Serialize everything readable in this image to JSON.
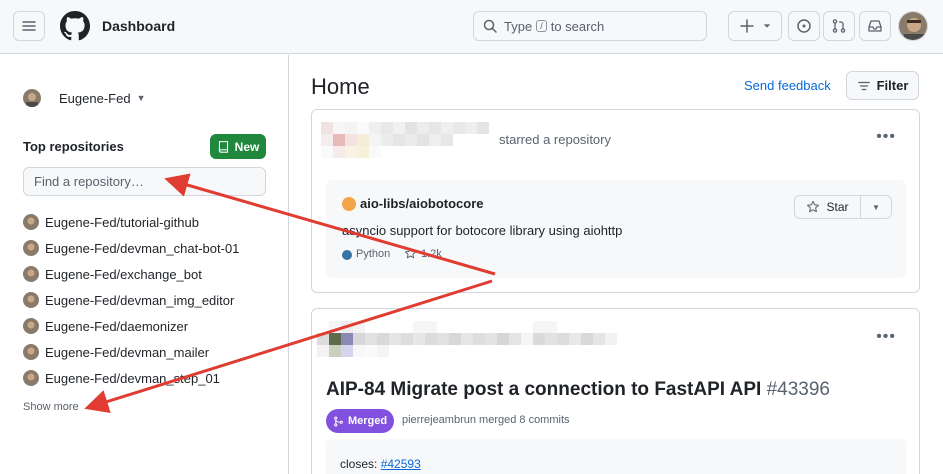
{
  "header": {
    "title": "Dashboard",
    "search_pre": "Type",
    "search_key": "/",
    "search_post": "to search"
  },
  "sidebar": {
    "user": "Eugene-Fed",
    "top_repos_title": "Top repositories",
    "new_label": "New",
    "find_placeholder": "Find a repository…",
    "repos": [
      "Eugene-Fed/tutorial-github",
      "Eugene-Fed/devman_chat-bot-01",
      "Eugene-Fed/exchange_bot",
      "Eugene-Fed/devman_img_editor",
      "Eugene-Fed/daemonizer",
      "Eugene-Fed/devman_mailer",
      "Eugene-Fed/devman_step_01"
    ],
    "show_more": "Show more"
  },
  "main": {
    "title": "Home",
    "send_feedback": "Send feedback",
    "filter": "Filter",
    "card1": {
      "action": "starred a repository",
      "repo_name": "aio-libs/aiobotocore",
      "description": "asyncio support for botocore library using aiohttp",
      "language": "Python",
      "language_color": "#3572A5",
      "stars": "1.2k",
      "star_label": "Star"
    },
    "card2": {
      "pr_title": "AIP-84 Migrate post a connection to FastAPI API",
      "pr_number": "#43396",
      "badge": "Merged",
      "merged_text": "pierrejeambrun merged 8 commits",
      "closes_label": "closes:",
      "closes_link": "#42593"
    }
  },
  "colors": {
    "accent": "#0969da",
    "new_button": "#1f883d",
    "merged": "#8250df",
    "arrow": "#e03c31"
  }
}
